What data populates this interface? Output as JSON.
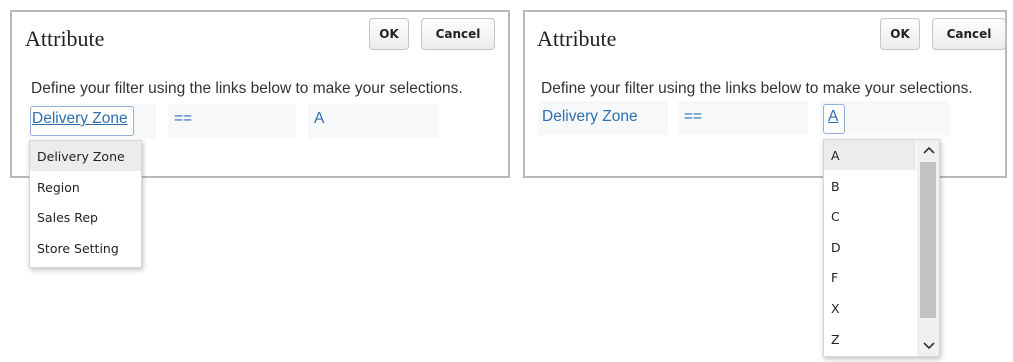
{
  "left": {
    "title": "Attribute",
    "ok_label": "OK",
    "cancel_label": "Cancel",
    "instruction": "Define your filter using the links below to make your selections.",
    "attribute": "Delivery Zone",
    "operator": "==",
    "value": "A",
    "dropdown": {
      "items": [
        "Delivery Zone",
        "Region",
        "Sales Rep",
        "Store Setting"
      ],
      "selected": "Delivery Zone"
    }
  },
  "right": {
    "title": "Attribute",
    "ok_label": "OK",
    "cancel_label": "Cancel",
    "instruction": "Define your filter using the links below to make your selections.",
    "attribute": "Delivery Zone",
    "operator": "==",
    "value": "A",
    "dropdown": {
      "items": [
        "A",
        "B",
        "C",
        "D",
        "F",
        "X",
        "Z"
      ],
      "selected": "A",
      "scroll_up_icon": "chevron-up-icon",
      "scroll_down_icon": "chevron-down-icon"
    }
  },
  "colors": {
    "link": "#2f6fad",
    "panel_border": "#b9b9b9",
    "cell_bg": "#f7f8fa",
    "selected_bg": "#ececec"
  }
}
